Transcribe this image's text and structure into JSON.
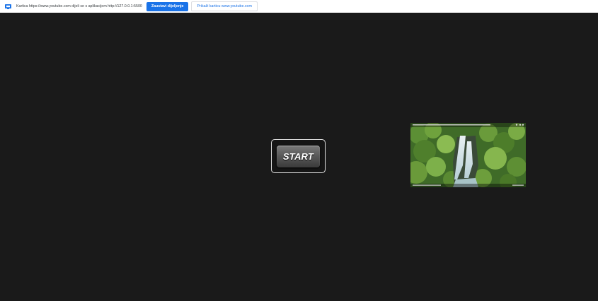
{
  "sharebar": {
    "message": "Kartica https://www.youtube.com dijeli se s aplikacijom http://127.0.0.1:5500",
    "stop_label": "Zaustavi dijeljenje",
    "show_label": "Prikaži karticu www.youtube.com",
    "icon": "screen-share-icon",
    "accent": "#1a73e8"
  },
  "main": {
    "background": "#1a1a1a",
    "start_label": "START",
    "video_thumbnail": "waterfall-forest-video"
  }
}
